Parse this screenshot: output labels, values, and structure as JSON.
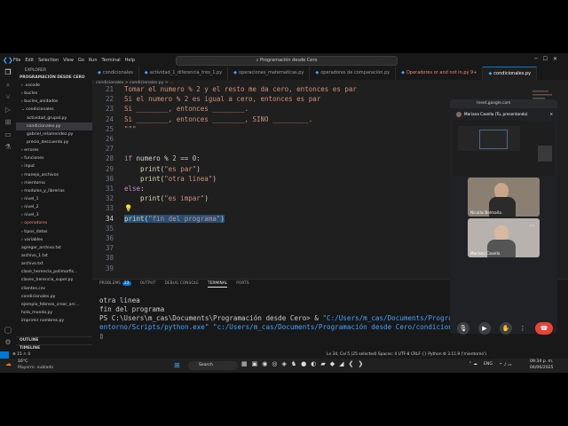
{
  "window": {
    "menu": [
      "File",
      "Edit",
      "Selection",
      "View",
      "Go",
      "Run",
      "Terminal",
      "Help"
    ],
    "search": "Programación desde Cero"
  },
  "sidebar": {
    "header": "EXPLORER",
    "root": "PROGRAMACIÓN DESDE CERO",
    "items": [
      {
        "label": "› .vscode",
        "depth": 1
      },
      {
        "label": "› bucles",
        "depth": 1
      },
      {
        "label": "› bucles_anidados",
        "depth": 1
      },
      {
        "label": "⌄ condicionales",
        "depth": 1
      },
      {
        "label": "actividad_grupal.py",
        "depth": 2
      },
      {
        "label": "condicionales.py",
        "depth": 2,
        "selected": true
      },
      {
        "label": "gabriel_relamendez.py",
        "depth": 2
      },
      {
        "label": "precio_descuento.py",
        "depth": 2
      },
      {
        "label": "› errores",
        "depth": 1
      },
      {
        "label": "› funciones",
        "depth": 1
      },
      {
        "label": "› input",
        "depth": 1
      },
      {
        "label": "› manejo_archivos",
        "depth": 1
      },
      {
        "label": "› mientorno",
        "depth": 1
      },
      {
        "label": "› modulos_y_librerias",
        "depth": 1
      },
      {
        "label": "› nivel_1",
        "depth": 1
      },
      {
        "label": "› nivel_2",
        "depth": 1
      },
      {
        "label": "› nivel_3",
        "depth": 1
      },
      {
        "label": "› operadores",
        "depth": 1,
        "error": true
      },
      {
        "label": "› tipos_datos",
        "depth": 1
      },
      {
        "label": "› variables",
        "depth": 1
      },
      {
        "label": "agregar_archivo.txt",
        "depth": 1
      },
      {
        "label": "archivo_1.txt",
        "depth": 1
      },
      {
        "label": "archivo.txt",
        "depth": 1
      },
      {
        "label": "clase_herencia_polimorfis...",
        "depth": 1
      },
      {
        "label": "clases_herencia_super.py",
        "depth": 1
      },
      {
        "label": "clientes.csv",
        "depth": 1
      },
      {
        "label": "condicionales.py",
        "depth": 1
      },
      {
        "label": "ejemplo_febrero_crear_arc...",
        "depth": 1
      },
      {
        "label": "hola_mundo.py",
        "depth": 1
      },
      {
        "label": "imprimir nombres.py",
        "depth": 1
      }
    ],
    "outline": "OUTLINE",
    "timeline": "TIMELINE"
  },
  "tabs": [
    {
      "label": "condicionales",
      "active": false
    },
    {
      "label": "actividad_1_diferencia_tres_1.py",
      "active": false
    },
    {
      "label": "operaciones_matematicas.py",
      "active": false
    },
    {
      "label": "operadores de comparación.py",
      "active": false
    },
    {
      "label": "Operadores or and not in.py 9+",
      "active": false,
      "error": true
    },
    {
      "label": "condicionales.py",
      "active": true
    }
  ],
  "breadcrumb": "condicionales > condicionales.py > ...",
  "editor": {
    "lines": [
      {
        "n": "21",
        "tokens": [
          {
            "t": "Tomar el numero % 2 y el resto me da cero, entonces es par",
            "c": "str"
          }
        ]
      },
      {
        "n": "22",
        "tokens": [
          {
            "t": "Si el numero % 2 es igual a cero, entonces es par",
            "c": "str"
          }
        ]
      },
      {
        "n": "23",
        "tokens": [
          {
            "t": "Si ________, entonces ________.",
            "c": "str"
          }
        ]
      },
      {
        "n": "24",
        "tokens": [
          {
            "t": "Si ________, entonces ________, SINO _________.",
            "c": "str"
          }
        ]
      },
      {
        "n": "25",
        "tokens": [
          {
            "t": "\"\"\"",
            "c": "str"
          }
        ]
      },
      {
        "n": "26",
        "tokens": []
      },
      {
        "n": "27",
        "tokens": []
      },
      {
        "n": "28",
        "tokens": [
          {
            "t": "if ",
            "c": "kw"
          },
          {
            "t": "numero ",
            "c": "plain"
          },
          {
            "t": "% ",
            "c": "plain"
          },
          {
            "t": "2",
            "c": "num"
          },
          {
            "t": " == ",
            "c": "plain"
          },
          {
            "t": "0",
            "c": "num"
          },
          {
            "t": ":",
            "c": "plain"
          }
        ]
      },
      {
        "n": "29",
        "tokens": [
          {
            "t": "    print",
            "c": "fn"
          },
          {
            "t": "(",
            "c": "plain"
          },
          {
            "t": "\"es par\"",
            "c": "str"
          },
          {
            "t": ")",
            "c": "plain"
          }
        ]
      },
      {
        "n": "30",
        "tokens": [
          {
            "t": "    print",
            "c": "fn"
          },
          {
            "t": "(",
            "c": "plain"
          },
          {
            "t": "\"otra linea\"",
            "c": "str"
          },
          {
            "t": ")",
            "c": "plain"
          }
        ]
      },
      {
        "n": "31",
        "tokens": [
          {
            "t": "else",
            "c": "kw"
          },
          {
            "t": ":",
            "c": "plain"
          }
        ]
      },
      {
        "n": "32",
        "tokens": [
          {
            "t": "    print",
            "c": "fn"
          },
          {
            "t": "(",
            "c": "plain"
          },
          {
            "t": "\"es impar\"",
            "c": "str"
          },
          {
            "t": ")",
            "c": "plain"
          }
        ]
      },
      {
        "n": "33",
        "tokens": [
          {
            "t": "💡",
            "c": "plain"
          }
        ]
      },
      {
        "n": "34",
        "tokens": [
          {
            "t": "print",
            "c": "fn",
            "hl": true
          },
          {
            "t": "(",
            "c": "plain",
            "hl": true
          },
          {
            "t": "\"fin del programa\"",
            "c": "str",
            "hl": true
          },
          {
            "t": ")",
            "c": "plain",
            "hl": true
          }
        ],
        "current": true
      },
      {
        "n": "35",
        "tokens": []
      },
      {
        "n": "36",
        "tokens": []
      },
      {
        "n": "37",
        "tokens": []
      },
      {
        "n": "38",
        "tokens": []
      },
      {
        "n": "39",
        "tokens": []
      }
    ]
  },
  "panel": {
    "tabs": [
      {
        "label": "PROBLEMS",
        "badge": "23"
      },
      {
        "label": "OUTPUT"
      },
      {
        "label": "DEBUG CONSOLE"
      },
      {
        "label": "TERMINAL",
        "active": true
      },
      {
        "label": "PORTS"
      }
    ],
    "terminal": {
      "line1": "otra linea",
      "line2": "fin del programa",
      "prompt": "PS C:\\Users\\m_cas\\Documents\\Programación desde Cero> & ",
      "cmd1": "\"C:/Users/m_cas/Documents/Programaci",
      "cmd2": "entorno/Scripts/python.exe\" \"c:/Users/m_cas/Documents/Programación desde Cero/condicionales"
    }
  },
  "status": {
    "left": "⊗ 15 ⚠ 0",
    "right": "Ln 34, Col 5 (25 selected)   Spaces: 4   UTF-8   CRLF   {} Python   ⚙ 3.11.9 ('mientorno')"
  },
  "taskbar": {
    "weather_temp": "16°C",
    "weather_desc": "Mayorm. nublado",
    "search": "Search",
    "lang": "ENG",
    "time": "09:34 p. m.",
    "date": "04/06/2025"
  },
  "meet": {
    "url": "meet.google.com",
    "presenter": "Mariana Casella (Tú, presentando)",
    "participant1": "Nicolás Belmaña",
    "participant2": "Mariana Casella",
    "colors": {
      "end_call": "#ea4335",
      "more": "#8ab4f8"
    }
  }
}
